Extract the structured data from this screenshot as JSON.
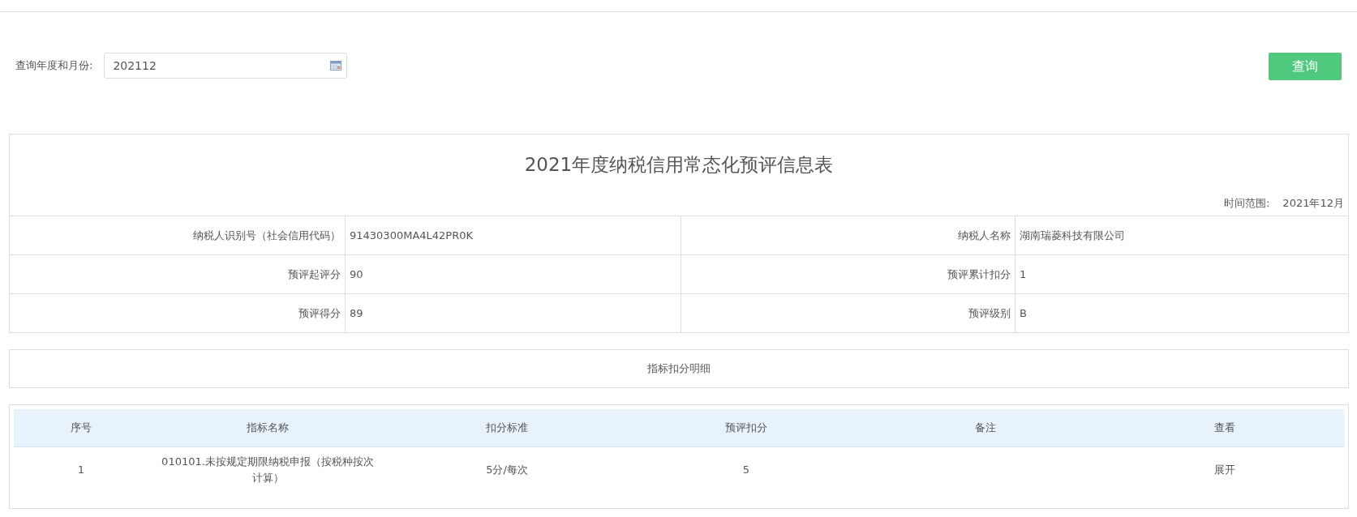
{
  "query": {
    "label": "查询年度和月份:",
    "value": "202112",
    "button": "查询"
  },
  "info_table": {
    "title": "2021年度纳税信用常态化预评信息表",
    "time_range_label": "时间范围:",
    "time_range_value": "2021年12月",
    "rows": [
      [
        {
          "label": "纳税人识别号（社会信用代码）",
          "value": "91430300MA4L42PR0K"
        },
        {
          "label": "纳税人名称",
          "value": "湖南瑞菱科技有限公司"
        }
      ],
      [
        {
          "label": "预评起评分",
          "value": "90"
        },
        {
          "label": "预评累计扣分",
          "value": "1"
        }
      ],
      [
        {
          "label": "预评得分",
          "value": "89"
        },
        {
          "label": "预评级别",
          "value": "B"
        }
      ]
    ]
  },
  "section_title": "指标扣分明细",
  "detail_table": {
    "columns": [
      "序号",
      "指标名称",
      "扣分标准",
      "预评扣分",
      "备注",
      "查看"
    ],
    "rows": [
      {
        "cells": [
          "1",
          "010101.未按规定期限纳税申报（按税种按次计算）",
          "5分/每次",
          "5",
          "",
          "展开"
        ]
      }
    ]
  }
}
